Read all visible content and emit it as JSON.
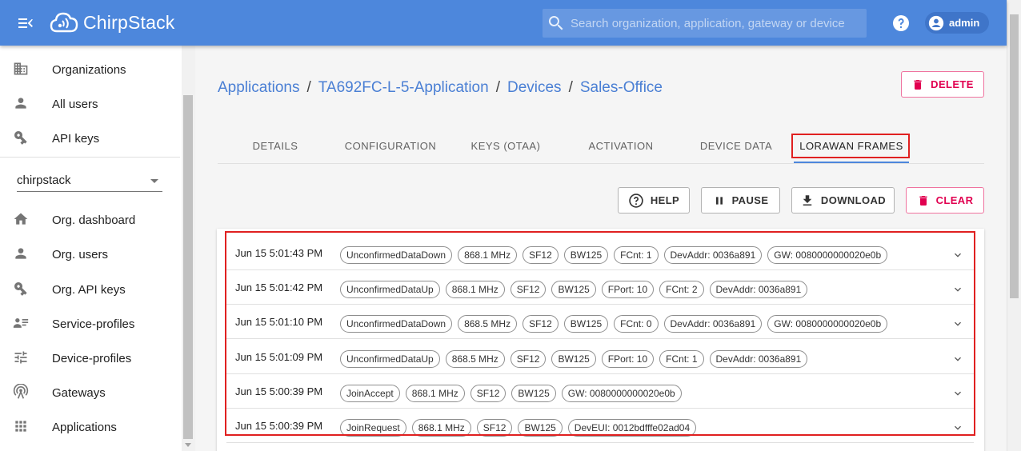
{
  "app": {
    "brand": "ChirpStack"
  },
  "search": {
    "placeholder": "Search organization, application, gateway or device"
  },
  "user": {
    "name": "admin"
  },
  "sidebar": {
    "top_items": [
      {
        "label": "Organizations",
        "icon": "building-icon"
      },
      {
        "label": "All users",
        "icon": "person-icon"
      },
      {
        "label": "API keys",
        "icon": "key-icon"
      }
    ],
    "organization": "chirpstack",
    "org_items": [
      {
        "label": "Org. dashboard",
        "icon": "home-icon"
      },
      {
        "label": "Org. users",
        "icon": "person-icon"
      },
      {
        "label": "Org. API keys",
        "icon": "key-icon"
      },
      {
        "label": "Service-profiles",
        "icon": "account-details-icon"
      },
      {
        "label": "Device-profiles",
        "icon": "tune-icon"
      },
      {
        "label": "Gateways",
        "icon": "radio-tower-icon"
      },
      {
        "label": "Applications",
        "icon": "apps-grid-icon"
      }
    ]
  },
  "breadcrumb": {
    "applications": "Applications",
    "application": "TA692FC-L-5-Application",
    "devices": "Devices",
    "device": "Sales-Office",
    "separator": "/"
  },
  "buttons": {
    "delete": "DELETE",
    "help": "HELP",
    "pause": "PAUSE",
    "download": "DOWNLOAD",
    "clear": "CLEAR"
  },
  "tabs": [
    {
      "label": "DETAILS"
    },
    {
      "label": "CONFIGURATION"
    },
    {
      "label": "KEYS (OTAA)"
    },
    {
      "label": "ACTIVATION"
    },
    {
      "label": "DEVICE DATA"
    },
    {
      "label": "LORAWAN FRAMES",
      "active": true
    }
  ],
  "frames": [
    {
      "time": "Jun 15 5:01:43 PM",
      "chips": [
        "UnconfirmedDataDown",
        "868.1 MHz",
        "SF12",
        "BW125",
        "FCnt: 1",
        "DevAddr: 0036a891",
        "GW: 0080000000020e0b"
      ]
    },
    {
      "time": "Jun 15 5:01:42 PM",
      "chips": [
        "UnconfirmedDataUp",
        "868.1 MHz",
        "SF12",
        "BW125",
        "FPort: 10",
        "FCnt: 2",
        "DevAddr: 0036a891"
      ]
    },
    {
      "time": "Jun 15 5:01:10 PM",
      "chips": [
        "UnconfirmedDataDown",
        "868.5 MHz",
        "SF12",
        "BW125",
        "FCnt: 0",
        "DevAddr: 0036a891",
        "GW: 0080000000020e0b"
      ]
    },
    {
      "time": "Jun 15 5:01:09 PM",
      "chips": [
        "UnconfirmedDataUp",
        "868.5 MHz",
        "SF12",
        "BW125",
        "FPort: 10",
        "FCnt: 1",
        "DevAddr: 0036a891"
      ]
    },
    {
      "time": "Jun 15 5:00:39 PM",
      "chips": [
        "JoinAccept",
        "868.1 MHz",
        "SF12",
        "BW125",
        "GW: 0080000000020e0b"
      ]
    },
    {
      "time": "Jun 15 5:00:39 PM",
      "chips": [
        "JoinRequest",
        "868.1 MHz",
        "SF12",
        "BW125",
        "DevEUI: 0012bdfffe02ad04"
      ]
    }
  ],
  "colors": {
    "appbar": "#4d87dc",
    "link": "#4a7fd4",
    "danger": "#e10050",
    "highlight": "#e02020"
  }
}
